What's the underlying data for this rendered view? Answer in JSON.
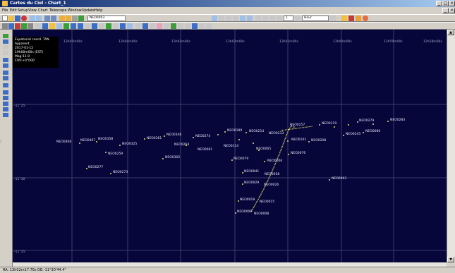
{
  "window": {
    "title": "Cartes du Ciel - Chart_1"
  },
  "menu": [
    "File",
    "Edit",
    "Setup",
    "View",
    "Chart",
    "Telescope",
    "Window",
    "Update",
    "Help"
  ],
  "toolbar": {
    "search_value": "NEO0003",
    "spin_value": "1",
    "time_unit": "Hour"
  },
  "info": {
    "line1": "Equatorial coord. TAN",
    "line2": "Apparent",
    "line3": "2017-01-12",
    "line4": "19h00m00s (EST)",
    "line5": "Mag:11.9",
    "line6": "FOV:+0°000'"
  },
  "grid": {
    "ra_labels": [
      "13h05m00s",
      "13h04m00s",
      "13h03m00s",
      "13h02m00s",
      "13h01m00s",
      "13h00m00s",
      "12h59m00s",
      "12h58m00s"
    ],
    "dec_labels": [
      "-11°25'",
      "-11°30'",
      "-11°35'"
    ]
  },
  "neos": [
    {
      "id": "NEO0408",
      "label": "NEO0408"
    },
    {
      "id": "NEO0407",
      "label": "NEO0407"
    },
    {
      "id": "NEO0358",
      "label": "NEO0358"
    },
    {
      "id": "NEO0325",
      "label": "NEO0325"
    },
    {
      "id": "NEO0259",
      "label": "NEO0259"
    },
    {
      "id": "NEO0277",
      "label": "NEO0277"
    },
    {
      "id": "NEO0273",
      "label": "NEO0273"
    },
    {
      "id": "NEO0361",
      "label": "NEO0361"
    },
    {
      "id": "NEO0348",
      "label": "NEO0348"
    },
    {
      "id": "NEO0264",
      "label": "NEO0264"
    },
    {
      "id": "NEO0302",
      "label": "NEO0302"
    },
    {
      "id": "NEO0274",
      "label": "NEO0274"
    },
    {
      "id": "NEO0081",
      "label": "NEO0081"
    },
    {
      "id": "NEO0189",
      "label": "NEO0189"
    },
    {
      "id": "NEO0214",
      "label": "NEO0214"
    },
    {
      "id": "NEO0233",
      "label": "NEO0233"
    },
    {
      "id": "NEO0257",
      "label": "NEO0257"
    },
    {
      "id": "NEO0114",
      "label": "NEO0114"
    },
    {
      "id": "NEO0005",
      "label": "NEO0005"
    },
    {
      "id": "NEO0079",
      "label": "NEO0079"
    },
    {
      "id": "NEO0006",
      "label": "NEO0006"
    },
    {
      "id": "NEO0041",
      "label": "NEO0041"
    },
    {
      "id": "NEO0058",
      "label": "NEO0058"
    },
    {
      "id": "NEO0029",
      "label": "NEO0029"
    },
    {
      "id": "NEO0026",
      "label": "NEO0026"
    },
    {
      "id": "NEO0018",
      "label": "NEO0018"
    },
    {
      "id": "NEO0015",
      "label": "NEO0015"
    },
    {
      "id": "NEO0009",
      "label": "NEO0009"
    },
    {
      "id": "NEO0008",
      "label": "NEO0008"
    },
    {
      "id": "NEO0101",
      "label": "NEO0101"
    },
    {
      "id": "NEO0208",
      "label": "NEO0208"
    },
    {
      "id": "NEO0076",
      "label": "NEO0076"
    },
    {
      "id": "NEO0319",
      "label": "NEO0319"
    },
    {
      "id": "NEO0279",
      "label": "NEO0279"
    },
    {
      "id": "NEO0283",
      "label": "NEO0283"
    },
    {
      "id": "NEO0245",
      "label": "NEO0245"
    },
    {
      "id": "NEO0086",
      "label": "NEO0086"
    },
    {
      "id": "NEO0003",
      "label": "NEO0003"
    }
  ],
  "status": {
    "text": "RA: 13h02m17.76s DE:-11°30'44.4\""
  },
  "colors": {
    "sky": "#06063a",
    "neo": "#e6e26a",
    "grid": "#3c3c6e"
  }
}
